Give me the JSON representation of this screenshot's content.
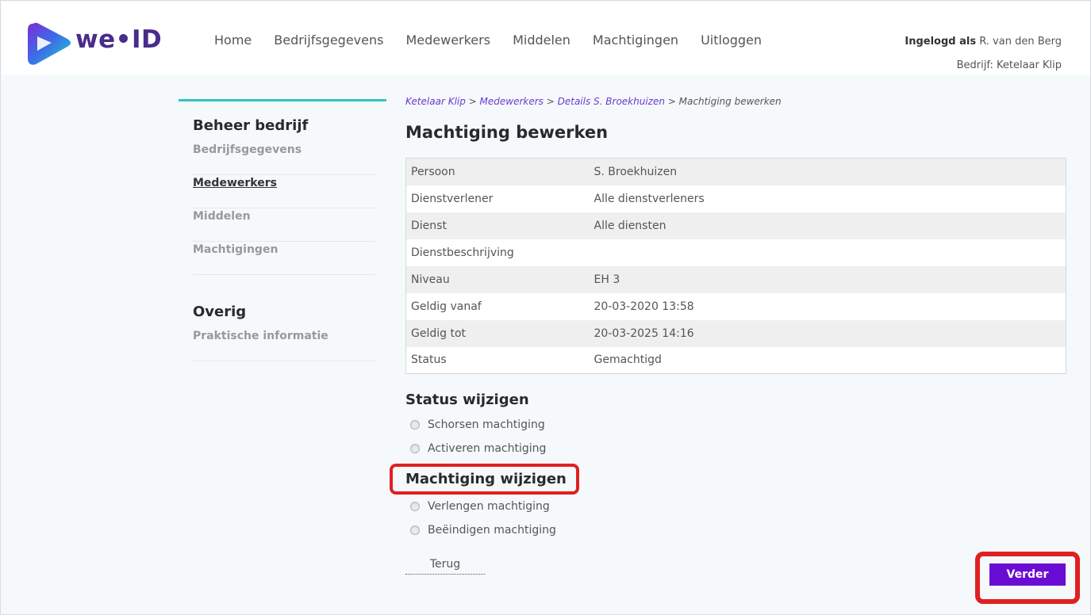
{
  "brand": {
    "logo_text": "we•ID",
    "colors": {
      "accent": "#6a0dd4",
      "teal": "#2ec7c0",
      "highlight": "#e02020",
      "logo_purple": "#4a2c8a"
    }
  },
  "nav": {
    "items": [
      "Home",
      "Bedrijfsgegevens",
      "Medewerkers",
      "Middelen",
      "Machtigingen",
      "Uitloggen"
    ]
  },
  "user": {
    "logged_in_label": "Ingelogd als",
    "name": "R. van den Berg",
    "company_line": "Bedrijf: Ketelaar Klip"
  },
  "sidebar": {
    "heading1": "Beheer bedrijf",
    "items1": [
      "Bedrijfsgegevens",
      "Medewerkers",
      "Middelen",
      "Machtigingen"
    ],
    "heading2": "Overig",
    "items2": [
      "Praktische informatie"
    ]
  },
  "breadcrumb": {
    "c1": "Ketelaar Klip",
    "c2": "Medewerkers",
    "c3": "Details S. Broekhuizen",
    "c4": "Machtiging bewerken",
    "sep": " > "
  },
  "main": {
    "title": "Machtiging bewerken",
    "rows": [
      {
        "label": "Persoon",
        "value": "S. Broekhuizen"
      },
      {
        "label": "Dienstverlener",
        "value": "Alle dienstverleners"
      },
      {
        "label": "Dienst",
        "value": "Alle diensten"
      },
      {
        "label": "Dienstbeschrijving",
        "value": ""
      },
      {
        "label": "Niveau",
        "value": "EH 3"
      },
      {
        "label": "Geldig vanaf",
        "value": "20-03-2020 13:58"
      },
      {
        "label": "Geldig tot",
        "value": "20-03-2025 14:16"
      },
      {
        "label": "Status",
        "value": "Gemachtigd"
      }
    ],
    "status_title": "Status wijzigen",
    "status_options": [
      "Schorsen machtiging",
      "Activeren machtiging"
    ],
    "change_title": "Machtiging wijzigen",
    "change_options": [
      "Verlengen machtiging",
      "Beëindigen machtiging"
    ],
    "back_label": "Terug",
    "next_label": "Verder"
  }
}
